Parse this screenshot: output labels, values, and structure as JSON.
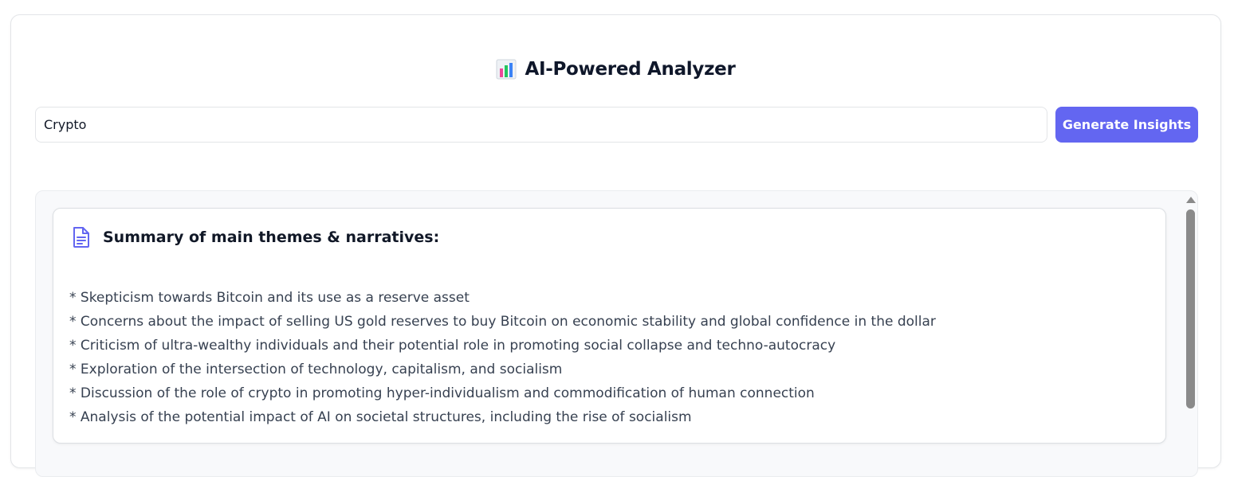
{
  "app": {
    "title": "AI-Powered Analyzer",
    "title_icon": "bar-chart-icon",
    "accent_color": "#6366f1"
  },
  "search": {
    "value": "Crypto",
    "placeholder": ""
  },
  "actions": {
    "generate_label": "Generate Insights"
  },
  "summary": {
    "icon": "document-icon",
    "title": "Summary of main themes & narratives:",
    "items": [
      "* Skepticism towards Bitcoin and its use as a reserve asset",
      "* Concerns about the impact of selling US gold reserves to buy Bitcoin on economic stability and global confidence in the dollar",
      "* Criticism of ultra-wealthy individuals and their potential role in promoting social collapse and techno-autocracy",
      "* Exploration of the intersection of technology, capitalism, and socialism",
      "* Discussion of the role of crypto in promoting hyper-individualism and commodification of human connection",
      "* Analysis of the potential impact of AI on societal structures, including the rise of socialism"
    ]
  }
}
